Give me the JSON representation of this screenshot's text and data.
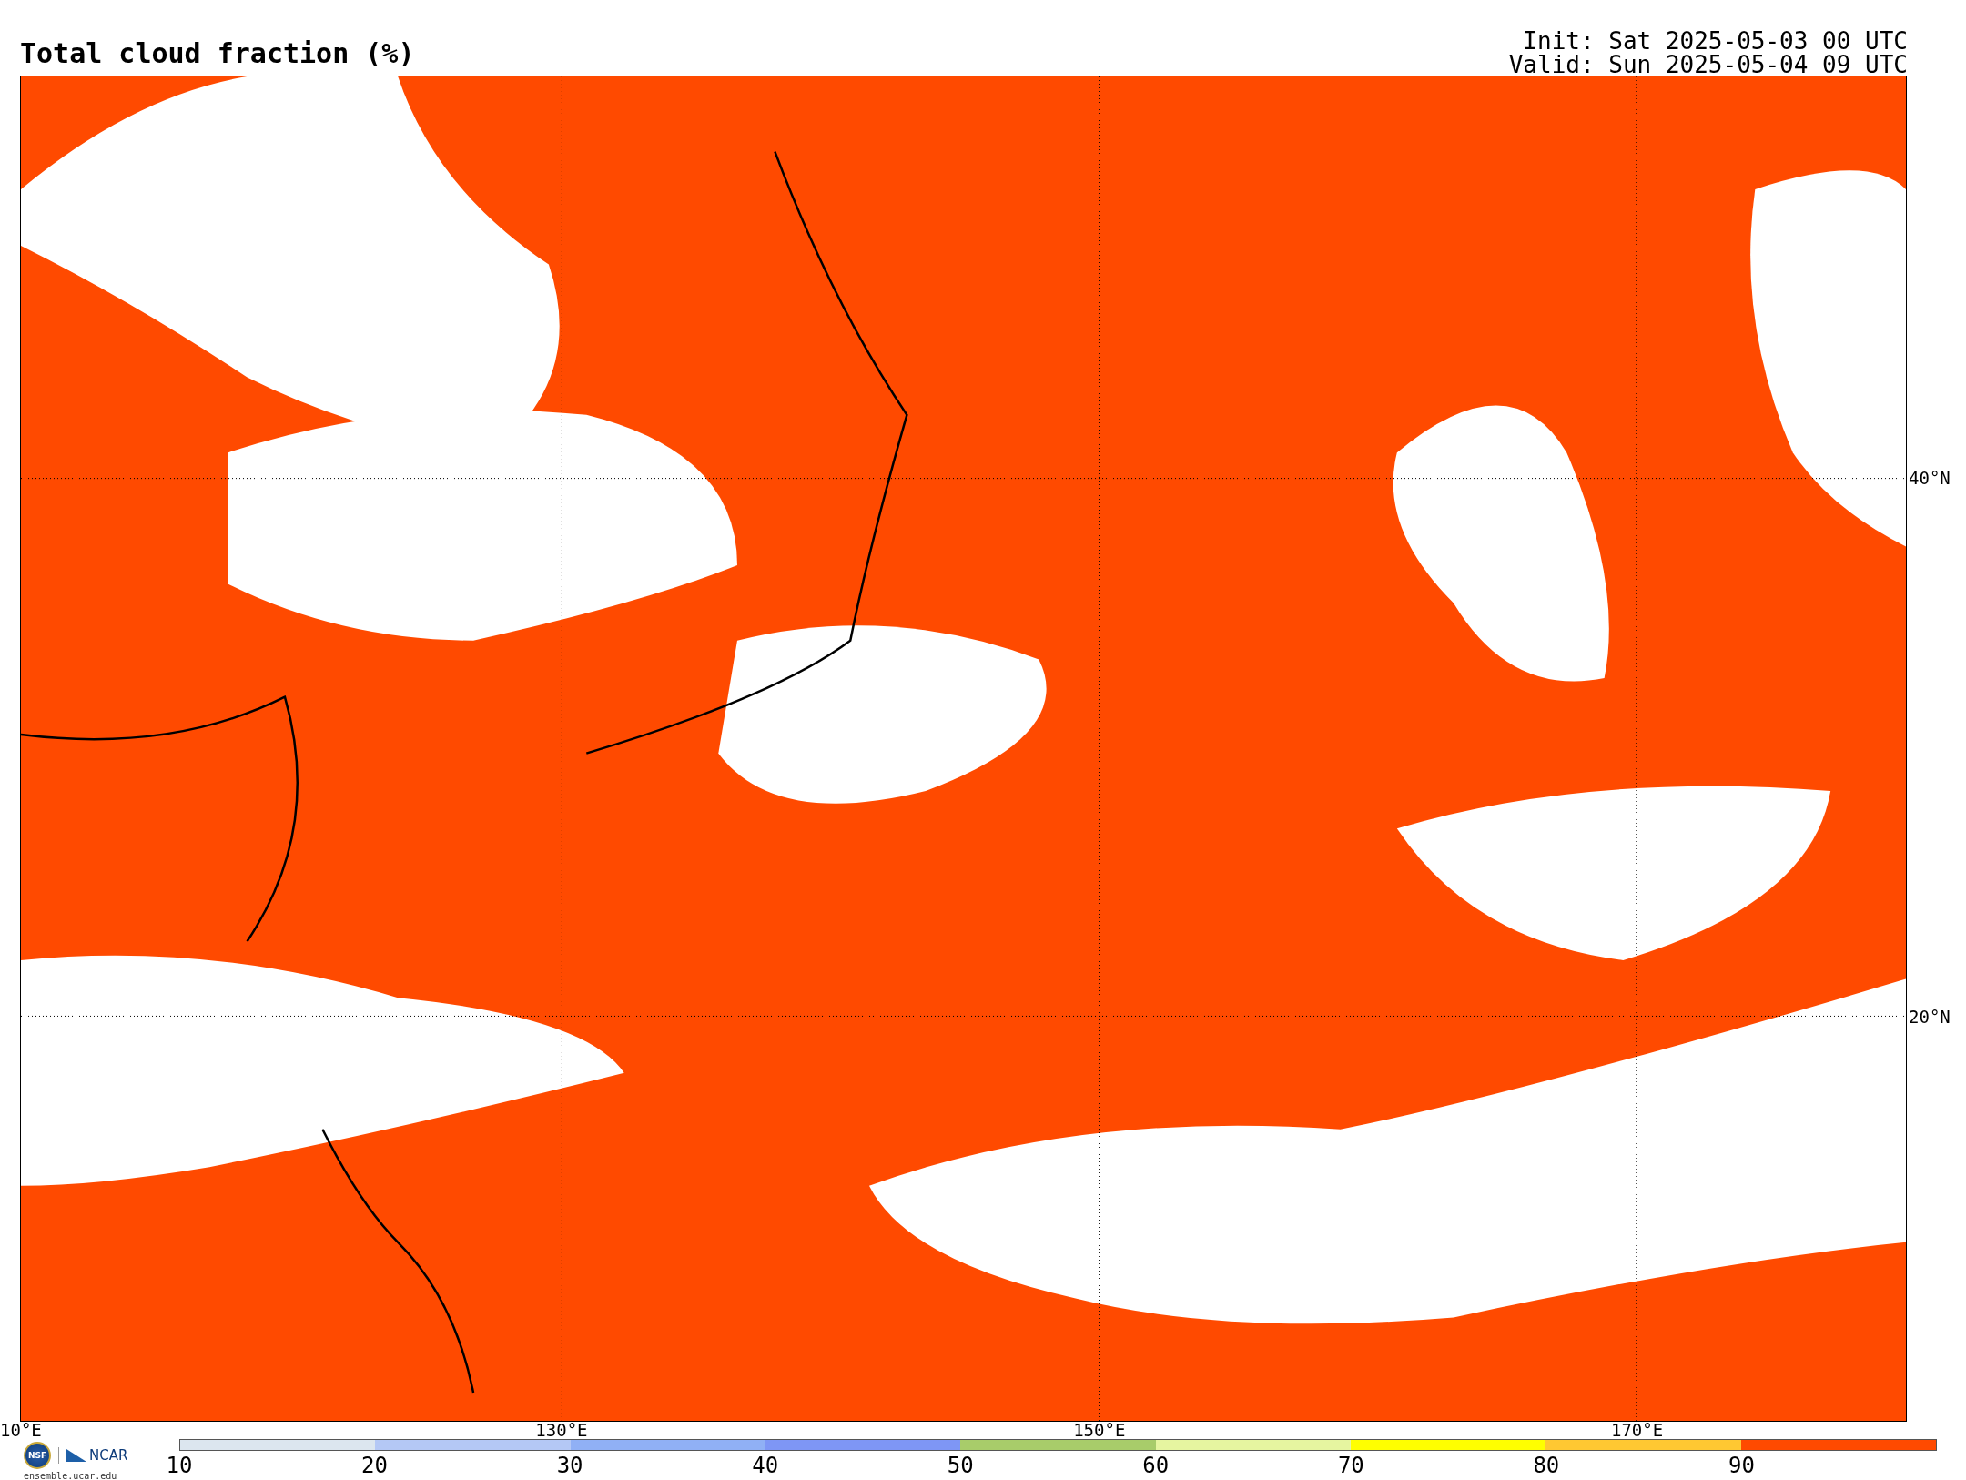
{
  "title": "Total cloud fraction (%)",
  "init": "Init: Sat 2025-05-03 00 UTC",
  "valid": "Valid: Sun 2025-05-04 09 UTC",
  "map": {
    "lat_labels": [
      "40°N",
      "20°N"
    ],
    "lon_labels": [
      "10°E",
      "130°E",
      "150°E",
      "170°E"
    ]
  },
  "logo": {
    "nsf": "NSF",
    "ncar": "NCAR",
    "url": "ensemble.ucar.edu"
  },
  "colorbar": {
    "bins": [
      {
        "color": "#dce6ef"
      },
      {
        "color": "#b4c8f5"
      },
      {
        "color": "#90b0f5"
      },
      {
        "color": "#7e96f5"
      },
      {
        "color": "#a8cc6a"
      },
      {
        "color": "#e6f5a0"
      },
      {
        "color": "#ffff00"
      },
      {
        "color": "#ffc832"
      },
      {
        "color": "#ff4a00"
      }
    ],
    "labels": [
      "10",
      "20",
      "30",
      "40",
      "50",
      "60",
      "70",
      "80",
      "90"
    ]
  }
}
